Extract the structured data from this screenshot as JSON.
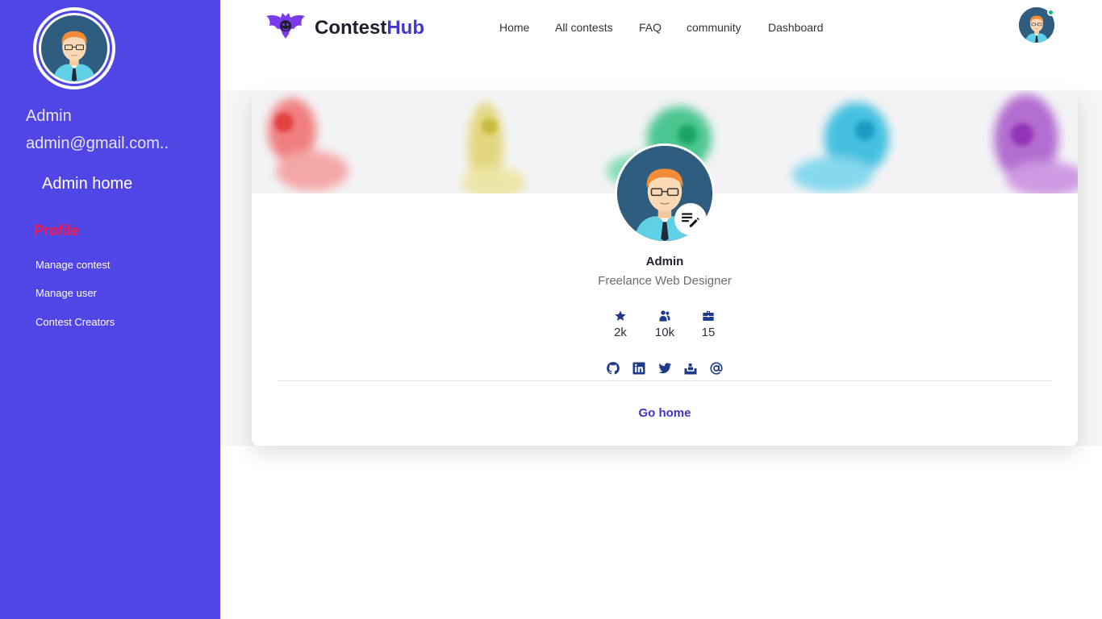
{
  "sidebar": {
    "name": "Admin",
    "email": "admin@gmail.com..",
    "home_link": "Admin home",
    "active_item": "Profile",
    "links": [
      "Manage contest",
      "Manage user",
      "Contest Creators"
    ]
  },
  "navbar": {
    "brand_part1": "Contest",
    "brand_part2": "Hub",
    "items": [
      "Home",
      "All contests",
      "FAQ",
      "community",
      "Dashboard"
    ],
    "online_status_color": "#10b981"
  },
  "profile": {
    "name": "Admin",
    "role": "Freelance Web Designer",
    "stats": [
      {
        "icon": "star-icon",
        "value": "2k"
      },
      {
        "icon": "users-icon",
        "value": "10k"
      },
      {
        "icon": "briefcase-icon",
        "value": "15"
      }
    ],
    "social": [
      "github-icon",
      "linkedin-icon",
      "twitter-icon",
      "stack-overflow-icon",
      "at-sign-icon"
    ],
    "action": "Go home"
  },
  "colors": {
    "sidebar": "#4f46e5",
    "accent": "#4338ca",
    "active": "#ff1744",
    "icon": "#1e3a8a"
  }
}
